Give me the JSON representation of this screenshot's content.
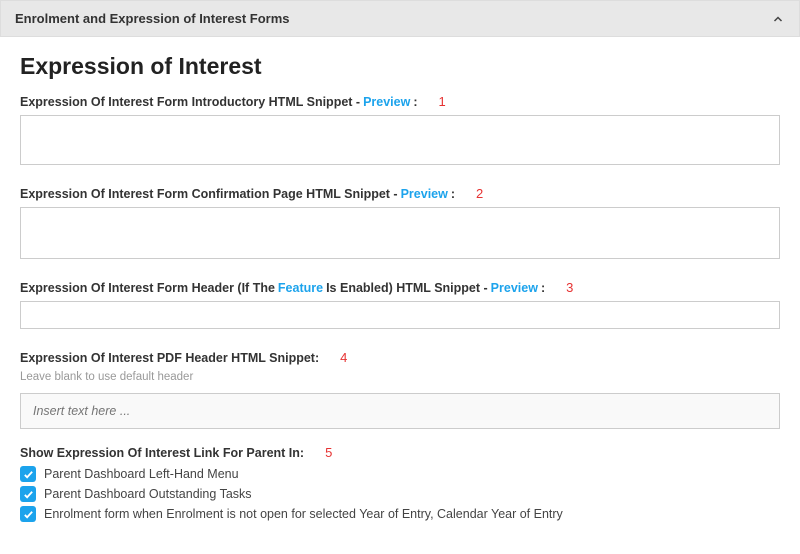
{
  "header": {
    "title": "Enrolment and Expression of Interest Forms"
  },
  "page": {
    "title": "Expression of Interest"
  },
  "annotations": {
    "n1": "1",
    "n2": "2",
    "n3": "3",
    "n4": "4",
    "n5": "5"
  },
  "fields": {
    "intro": {
      "label_prefix": "Expression Of Interest Form Introductory HTML Snippet - ",
      "preview": "Preview",
      "suffix": " :"
    },
    "confirmation": {
      "label_prefix": "Expression Of Interest Form Confirmation Page HTML Snippet - ",
      "preview": "Preview",
      "suffix": " :"
    },
    "header_snippet": {
      "prefix": "Expression Of Interest Form Header (If The ",
      "feature_link": "Feature",
      "middle": " Is Enabled) HTML Snippet - ",
      "preview": "Preview",
      "suffix": " :"
    },
    "pdf_header": {
      "label": "Expression Of Interest PDF Header HTML Snippet:",
      "hint": "Leave blank to use default header",
      "placeholder": "Insert text here ..."
    },
    "show_link": {
      "label": "Show Expression Of Interest Link For Parent In:",
      "options": [
        "Parent Dashboard Left-Hand Menu",
        "Parent Dashboard Outstanding Tasks",
        "Enrolment form when Enrolment is not open for selected Year of Entry, Calendar Year of Entry"
      ]
    }
  }
}
